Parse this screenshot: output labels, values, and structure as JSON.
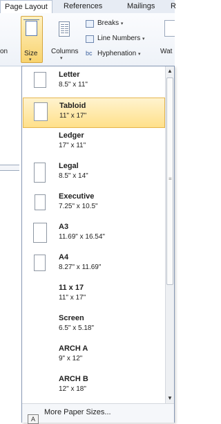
{
  "tabs": [
    {
      "label": "Page Layout",
      "active": true
    },
    {
      "label": "References",
      "active": false
    },
    {
      "label": "Mailings",
      "active": false
    },
    {
      "label": "R",
      "active": false
    }
  ],
  "ribbon": {
    "partial_left_label": "on",
    "size_label": "Size",
    "columns_label": "Columns",
    "breaks_label": "Breaks",
    "line_numbers_label": "Line Numbers",
    "hyphenation_label": "Hyphenation",
    "watermark_partial_label": "Wat",
    "caret": "▾"
  },
  "paper_sizes": [
    {
      "name": "Letter",
      "dimensions": "8.5\" x 11\"",
      "selected": false
    },
    {
      "name": "Tabloid",
      "dimensions": "11\" x 17\"",
      "selected": true
    },
    {
      "name": "Ledger",
      "dimensions": "17\" x 11\"",
      "selected": false
    },
    {
      "name": "Legal",
      "dimensions": "8.5\" x 14\"",
      "selected": false
    },
    {
      "name": "Executive",
      "dimensions": "7.25\" x 10.5\"",
      "selected": false
    },
    {
      "name": "A3",
      "dimensions": "11.69\" x 16.54\"",
      "selected": false
    },
    {
      "name": "A4",
      "dimensions": "8.27\" x 11.69\"",
      "selected": false
    },
    {
      "name": "11 x 17",
      "dimensions": "11\" x 17\"",
      "selected": false
    },
    {
      "name": "Screen",
      "dimensions": "6.5\" x 5.18\"",
      "selected": false
    },
    {
      "name": "ARCH A",
      "dimensions": "9\" x 12\"",
      "selected": false
    },
    {
      "name": "ARCH B",
      "dimensions": "12\" x 18\"",
      "selected": false
    }
  ],
  "more_paper_sizes_label": "More Paper Sizes...",
  "key_tip": "A",
  "colors": {
    "selection": "#ffe08a",
    "selection_border": "#e5b54c",
    "ribbon_bg": "#eef2f8",
    "thumb_border": "#8e97a3"
  },
  "icons": [
    "size-page-icon",
    "columns-icon",
    "breaks-icon",
    "line-numbers-icon",
    "hyphenation-icon",
    "scroll-up-arrow-icon",
    "scroll-down-arrow-icon",
    "paper-thumbnail-icon"
  ]
}
